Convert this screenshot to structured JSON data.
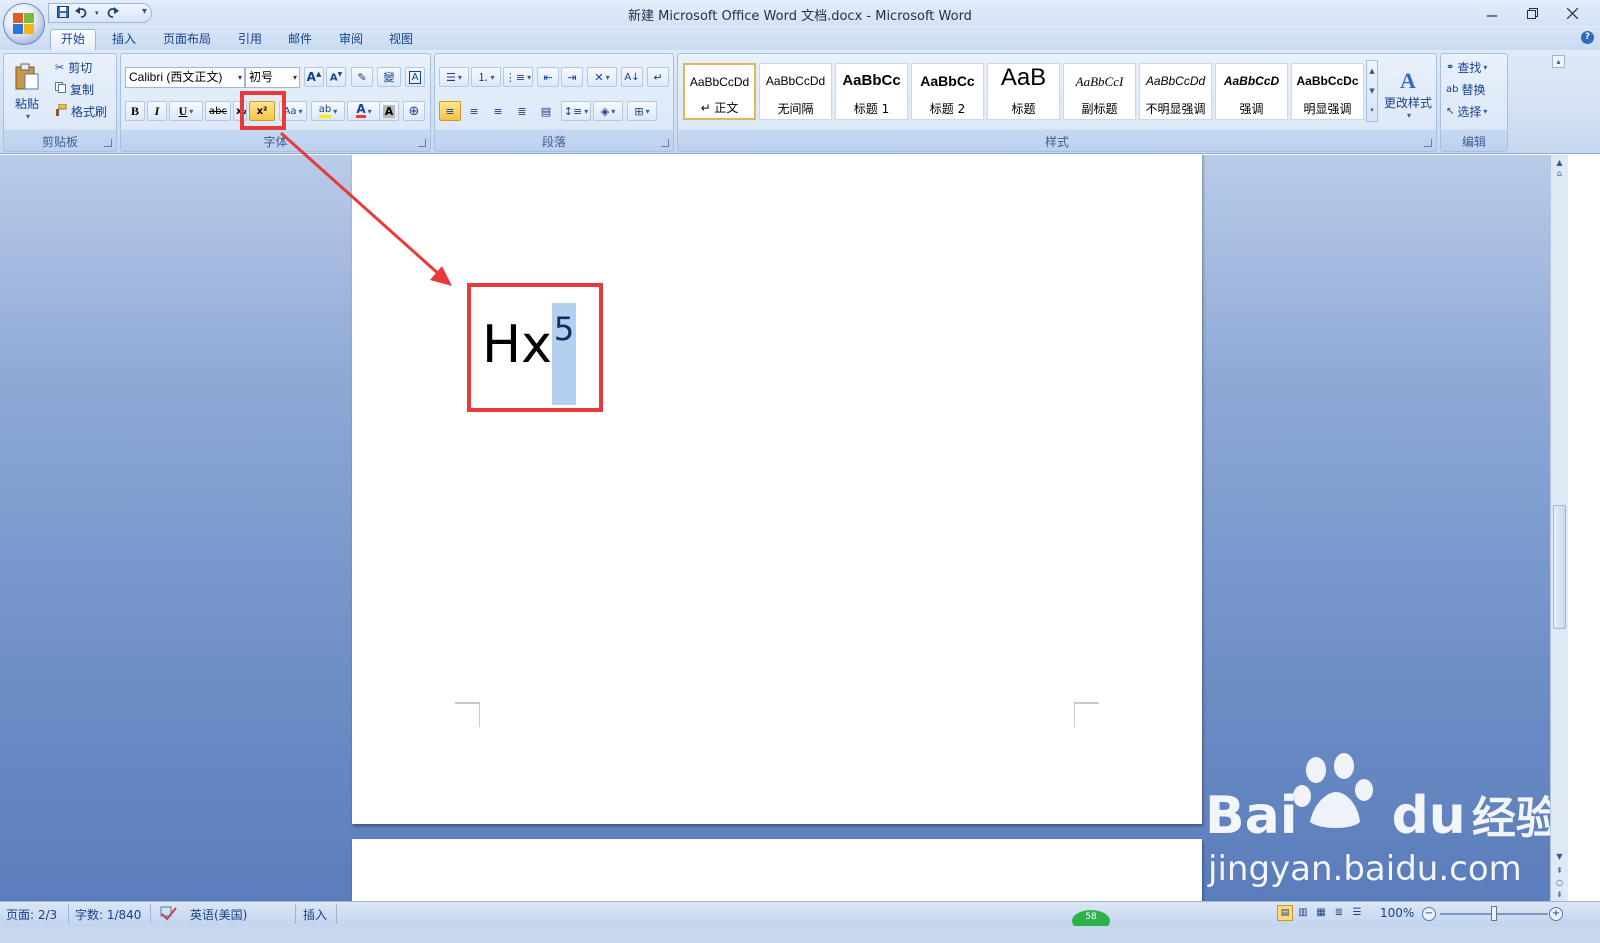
{
  "window": {
    "title": "新建 Microsoft Office Word 文档.docx - Microsoft Word"
  },
  "quick_access": {
    "save_icon": "save-icon",
    "undo_icon": "undo-icon",
    "redo_icon": "redo-icon"
  },
  "tabs": [
    {
      "label": "开始",
      "active": true
    },
    {
      "label": "插入"
    },
    {
      "label": "页面布局"
    },
    {
      "label": "引用"
    },
    {
      "label": "邮件"
    },
    {
      "label": "审阅"
    },
    {
      "label": "视图"
    }
  ],
  "clipboard": {
    "paste_label": "粘贴",
    "cut_label": "剪切",
    "copy_label": "复制",
    "format_painter_label": "格式刷",
    "group_label": "剪贴板"
  },
  "font": {
    "font_name": "Calibri (西文正文)",
    "font_size": "初号",
    "bold_label": "B",
    "italic_label": "I",
    "underline_label": "U",
    "strike_label": "abc",
    "subscript_label": "x₂",
    "superscript_label": "x²",
    "case_label": "Aa",
    "highlight_label": "ab",
    "font_color_label": "A",
    "group_label": "字体"
  },
  "paragraph": {
    "group_label": "段落"
  },
  "styles": {
    "items": [
      {
        "sample": "AaBbCcDd",
        "name": "↵ 正文"
      },
      {
        "sample": "AaBbCcDd",
        "name": "无间隔"
      },
      {
        "sample": "AaBbCc",
        "name": "标题 1"
      },
      {
        "sample": "AaBbCc",
        "name": "标题 2"
      },
      {
        "sample": "AaB",
        "name": "标题"
      },
      {
        "sample": "AaBbCcI",
        "name": "副标题"
      },
      {
        "sample": "AaBbCcDd",
        "name": "不明显强调"
      },
      {
        "sample": "AaBbCcD",
        "name": "强调"
      },
      {
        "sample": "AaBbCcDc",
        "name": "明显强调"
      }
    ],
    "change_styles_label": "更改样式",
    "group_label": "样式"
  },
  "editing": {
    "find_label": "查找",
    "replace_label": "替换",
    "select_label": "选择",
    "group_label": "编辑"
  },
  "document": {
    "base_text": "Hx",
    "superscript_text": "5"
  },
  "statusbar": {
    "page": "页面: 2/3",
    "words": "字数: 1/840",
    "language": "英语(美国)",
    "mode": "插入",
    "zoom": "100%"
  },
  "watermark": {
    "brand": "Bai",
    "brand_du": "du",
    "cn": "经验",
    "url": "jingyan.baidu.com"
  },
  "colors": {
    "annotation_red": "#e8393b",
    "selection_blue": "#b4cff0",
    "ribbon_text": "#15428b"
  }
}
